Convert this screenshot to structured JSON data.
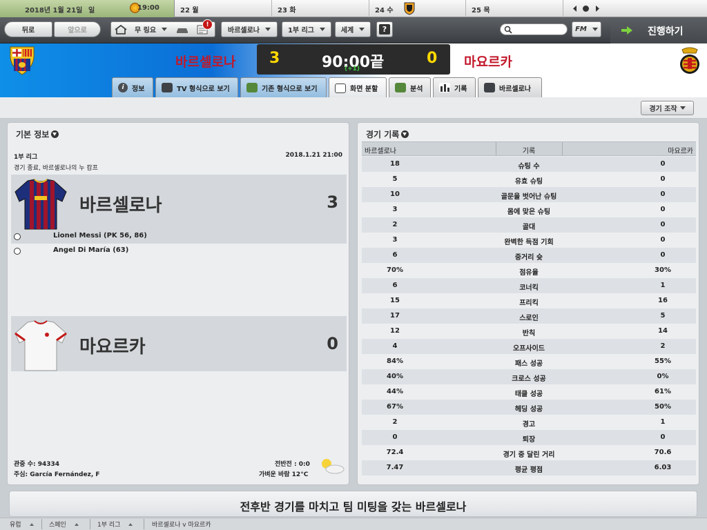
{
  "calendar": {
    "current_date": "2018년 1월 21일",
    "current_weekday": "일",
    "current_time": "19:00",
    "days": [
      {
        "label": "22 월"
      },
      {
        "label": "23 화"
      },
      {
        "label": "24 수"
      },
      {
        "label": "25 목"
      }
    ],
    "prev_icon": "chevron-left-icon",
    "next_icon": "chevron-right-icon"
  },
  "toolbar": {
    "back_label": "뒤로",
    "forward_label": "앞으로",
    "inbox_label": "무 링요",
    "club_label": "바르셀로나",
    "league_label": "1부 리그",
    "world_label": "세계",
    "help_label": "?",
    "fm_label": "FM",
    "continue_label": "진행하기",
    "alert_badge": "!"
  },
  "match": {
    "home_team": "바르셀로나",
    "away_team": "마요르카",
    "home_score": "3",
    "away_score": "0",
    "clock": "90:00끝",
    "added_time": "(+1)",
    "home_color": "#c2182a",
    "score_color": "#ffd800"
  },
  "tabs": [
    {
      "label": "정보",
      "icon": "info-icon"
    },
    {
      "label": "TV 형식으로 보기",
      "icon": "tv-icon"
    },
    {
      "label": "기존 형식으로 보기",
      "icon": "pitch-icon"
    },
    {
      "label": "화면 분할",
      "icon": "split-screen-icon"
    },
    {
      "label": "분석",
      "icon": "analysis-icon"
    },
    {
      "label": "기록",
      "icon": "stats-icon"
    },
    {
      "label": "바르셀로나",
      "icon": "team-icon"
    }
  ],
  "subbar": {
    "match_control_label": "경기 조작"
  },
  "basic_info": {
    "title": "기본 정보",
    "league": "1부 리그",
    "datetime": "2018.1.21 21:00",
    "venue": "경기 종료, 바르셀로나의 누 캄프",
    "home": {
      "name": "바르셀로나",
      "score": "3"
    },
    "away": {
      "name": "마요르카",
      "score": "0"
    },
    "scorers": [
      "Lionel Messi (PK 56, 86)",
      "Angel Di María (63)"
    ],
    "attendance": "관중 수: 94334",
    "referee": "주심: García Fernández, F",
    "halftime": "전반전 : 0:0",
    "weather": "가벼운 바람 12°C"
  },
  "stats": {
    "title": "경기 기록",
    "header": {
      "home": "바르셀로나",
      "label": "기록",
      "away": "마요르카"
    },
    "rows": [
      {
        "home": "18",
        "label": "슈팅 수",
        "away": "0"
      },
      {
        "home": "5",
        "label": "유효 슈팅",
        "away": "0"
      },
      {
        "home": "10",
        "label": "골문을 벗어난 슈팅",
        "away": "0"
      },
      {
        "home": "3",
        "label": "몸에 맞은 슈팅",
        "away": "0"
      },
      {
        "home": "2",
        "label": "골대",
        "away": "0"
      },
      {
        "home": "3",
        "label": "완벽한 득점 기회",
        "away": "0"
      },
      {
        "home": "6",
        "label": "중거리 슛",
        "away": "0"
      },
      {
        "home": "70%",
        "label": "점유율",
        "away": "30%"
      },
      {
        "home": "6",
        "label": "코너킥",
        "away": "1"
      },
      {
        "home": "15",
        "label": "프리킥",
        "away": "16"
      },
      {
        "home": "17",
        "label": "스로인",
        "away": "5"
      },
      {
        "home": "12",
        "label": "반칙",
        "away": "14"
      },
      {
        "home": "4",
        "label": "오프사이드",
        "away": "2"
      },
      {
        "home": "84%",
        "label": "패스 성공",
        "away": "55%"
      },
      {
        "home": "40%",
        "label": "크로스 성공",
        "away": "0%"
      },
      {
        "home": "44%",
        "label": "태클 성공",
        "away": "61%"
      },
      {
        "home": "67%",
        "label": "헤딩 성공",
        "away": "50%"
      },
      {
        "home": "2",
        "label": "경고",
        "away": "1"
      },
      {
        "home": "0",
        "label": "퇴장",
        "away": "0"
      },
      {
        "home": "72.4",
        "label": "경기 중 달린 거리",
        "away": "70.6"
      },
      {
        "home": "7.47",
        "label": "평균 평점",
        "away": "6.03"
      }
    ]
  },
  "news": "전후반 경기를 마치고 팀 미팅을 갖는 바르셀로나",
  "breadcrumbs": [
    "유럽",
    "스페인",
    "1부 리그",
    "바르셀로나 v 마요르카"
  ]
}
